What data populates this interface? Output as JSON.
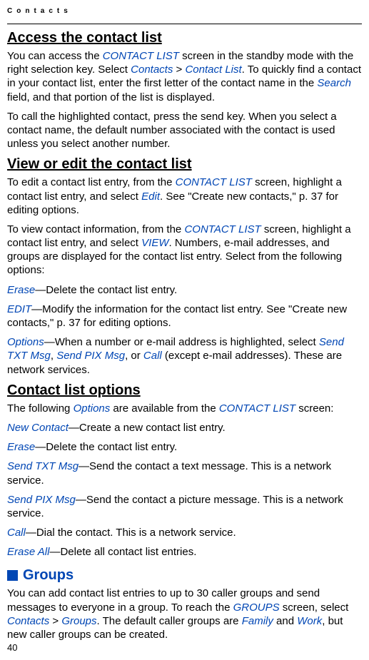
{
  "header": "Contacts",
  "pagenum": "40",
  "sections": {
    "access": {
      "title": "Access the contact list",
      "p1a": "You can access the ",
      "p1kw1": "CONTACT LIST",
      "p1b": " screen in the standby mode with the right selection key. Select ",
      "p1kw2": "Contacts",
      "p1c": " > ",
      "p1kw3": "Contact List",
      "p1d": ". To quickly find a contact in your contact list, enter the first letter of the contact name in the ",
      "p1kw4": "Search",
      "p1e": " field, and that portion of the list is displayed.",
      "p2": "To call the highlighted contact, press the send key. When you select a contact name, the default number associated with the contact is used unless you select another number."
    },
    "view": {
      "title": "View or edit the contact list",
      "p1a": "To edit a contact list entry, from the ",
      "p1kw1": "CONTACT LIST",
      "p1b": " screen, highlight a contact list entry, and select ",
      "p1kw2": "Edit",
      "p1c": ". See \"Create new contacts,\" p. 37 for editing options.",
      "p2a": "To view contact information, from the ",
      "p2kw1": "CONTACT LIST",
      "p2b": " screen, highlight a contact list entry, and select ",
      "p2kw2": "VIEW",
      "p2c": ". Numbers, e-mail addresses, and groups are displayed for the contact list entry. Select from the following options:",
      "erase_kw": "Erase",
      "erase_txt": "—Delete the contact list entry.",
      "edit_kw": "EDIT",
      "edit_txt": "—Modify the information for the contact list entry. See \"Create new contacts,\" p. 37 for editing options.",
      "opt_kw": "Options",
      "opt_a": "—When a number or e-mail address is highlighted, select ",
      "opt_kw1": "Send TXT Msg",
      "opt_b": ", ",
      "opt_kw2": "Send PIX Msg",
      "opt_c": ", or ",
      "opt_kw3": "Call",
      "opt_d": " (except e-mail addresses). These are network services."
    },
    "clo": {
      "title": "Contact list options",
      "p1a": "The following ",
      "p1kw1": "Options",
      "p1b": " are available from the ",
      "p1kw2": "CONTACT LIST",
      "p1c": " screen:",
      "nc_kw": "New Contact",
      "nc_txt": "—Create a new contact list entry.",
      "er_kw": "Erase",
      "er_txt": "—Delete the contact list entry.",
      "stxt_kw": "Send TXT Msg",
      "stxt_txt": "—Send the contact a text message. This is a network service.",
      "spix_kw": "Send PIX Msg",
      "spix_txt": "—Send the contact a picture message. This is a network service.",
      "call_kw": "Call",
      "call_txt": "—Dial the contact. This is a network service.",
      "ea_kw": "Erase All",
      "ea_txt": "—Delete all contact list entries."
    },
    "groups": {
      "title": "Groups",
      "p1a": "You can add contact list entries to up to 30 caller groups and send messages to everyone in a group. To reach the ",
      "p1kw1": "GROUPS",
      "p1b": " screen, select ",
      "p1kw2": "Contacts",
      "p1c": " > ",
      "p1kw3": "Groups",
      "p1d": ". The default caller groups are ",
      "p1kw4": "Family",
      "p1e": " and ",
      "p1kw5": "Work",
      "p1f": ", but new caller groups can be created."
    }
  }
}
